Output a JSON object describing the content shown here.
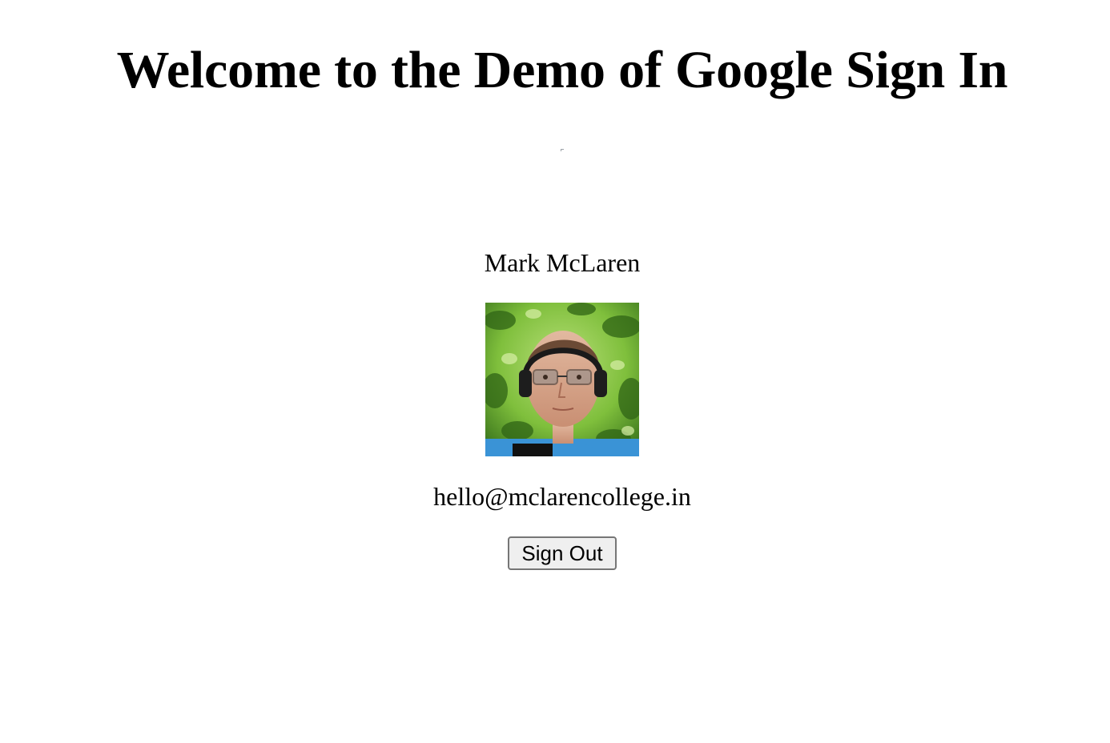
{
  "header": {
    "title": "Welcome to the Demo of Google Sign In"
  },
  "profile": {
    "name": "Mark McLaren",
    "avatar_alt": "Mark McLaren",
    "email": "hello@mclarencollege.in"
  },
  "actions": {
    "sign_out_label": "Sign Out"
  },
  "icons": {
    "google_signin": "google-signin-placeholder-icon"
  },
  "colors": {
    "background": "#ffffff",
    "text": "#000000",
    "button_background": "#efefef",
    "button_border": "#767676"
  }
}
